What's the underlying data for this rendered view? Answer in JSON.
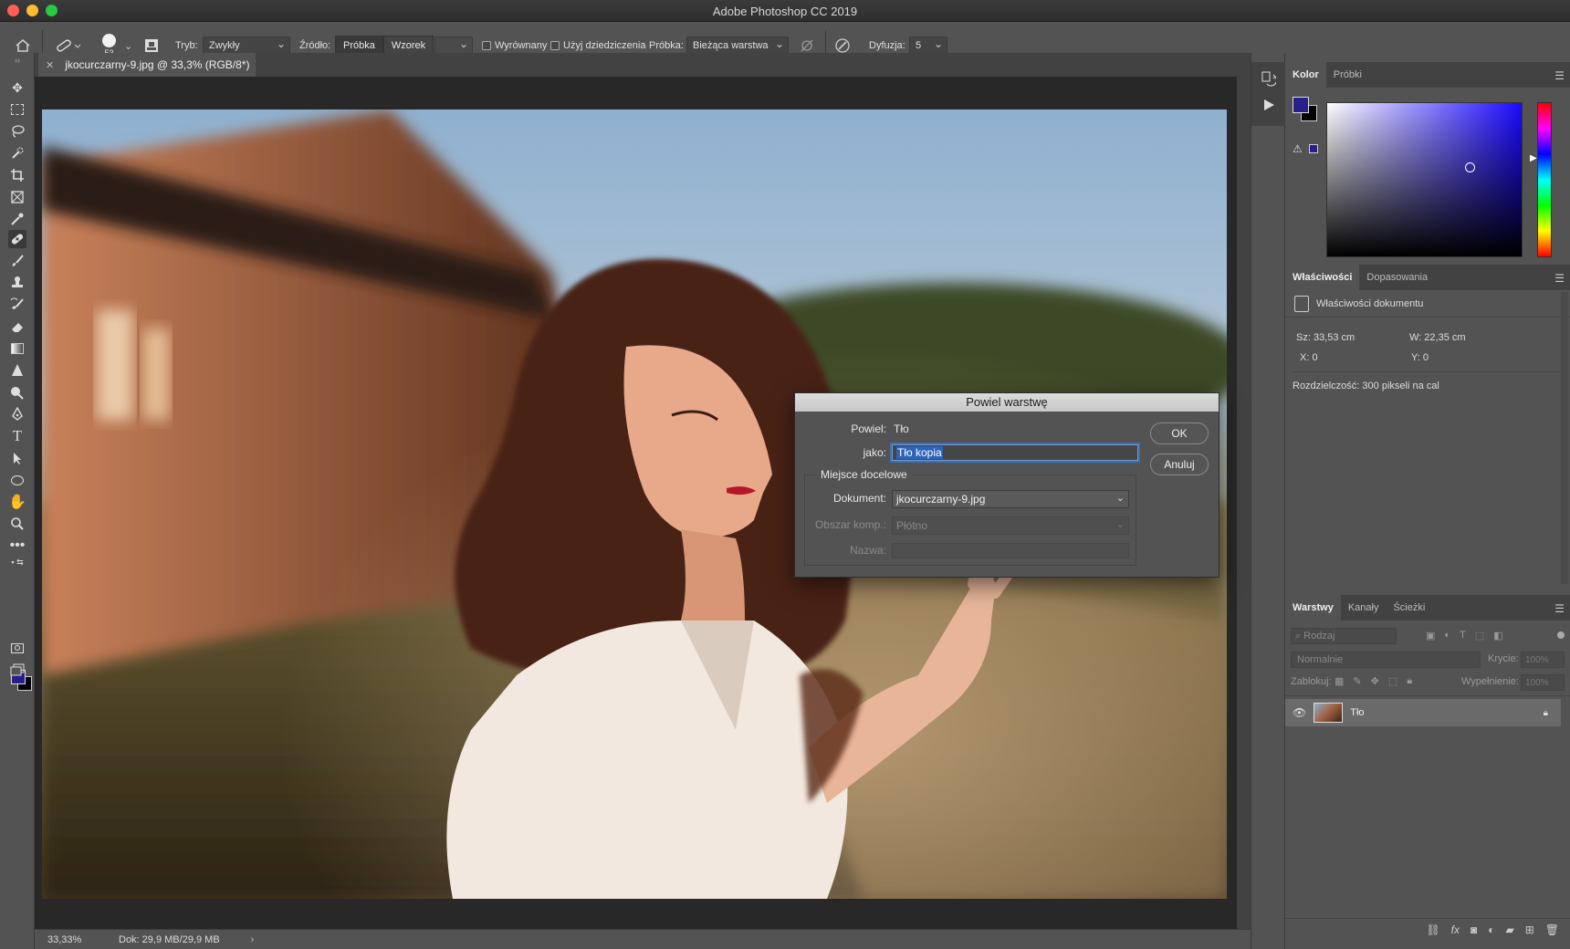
{
  "window": {
    "title": "Adobe Photoshop CC 2019"
  },
  "options_bar": {
    "brush_size": "53",
    "mode_label": "Tryb:",
    "mode_value": "Zwykły",
    "source_label": "Źródło:",
    "source_sampled": "Próbka",
    "source_pattern": "Wzorek",
    "aligned_label": "Wyrównany",
    "legacy_label": "Użyj dziedziczenia",
    "sample_label": "Próbka:",
    "sample_value": "Bieżąca warstwa",
    "diffusion_label": "Dyfuzja:",
    "diffusion_value": "5"
  },
  "document_tab": {
    "title": "jkocurczarny-9.jpg @ 33,3% (RGB/8*)"
  },
  "status_bar": {
    "zoom": "33,33%",
    "doc_info": "Dok: 29,9 MB/29,9 MB"
  },
  "color_panel": {
    "tabs": [
      "Kolor",
      "Próbki"
    ],
    "foreground": "#2a1f8a",
    "background": "#000000"
  },
  "properties_panel": {
    "tabs": [
      "Właściwości",
      "Dopasowania"
    ],
    "header": "Właściwości dokumentu",
    "width": "Sz: 33,53 cm",
    "height": "W: 22,35 cm",
    "x": "X: 0",
    "y": "Y: 0",
    "resolution": "Rozdzielczość: 300 pikseli na cal"
  },
  "layers_panel": {
    "tabs": [
      "Warstwy",
      "Kanały",
      "Ścieżki"
    ],
    "filter_placeholder": "Rodzaj",
    "blend_mode": "Normalnie",
    "opacity_label": "Krycie:",
    "opacity_value": "100%",
    "lock_label": "Zablokuj:",
    "fill_label": "Wypełnienie:",
    "fill_value": "100%",
    "layers": [
      {
        "name": "Tło"
      }
    ]
  },
  "dialog": {
    "title": "Powiel warstwę",
    "duplicate_label": "Powiel:",
    "duplicate_value": "Tło",
    "as_label": "jako:",
    "as_value": "Tło kopia",
    "destination_group": "Miejsce docelowe",
    "document_label": "Dokument:",
    "document_value": "jkocurczarny-9.jpg",
    "artboard_label": "Obszar komp.:",
    "artboard_value": "Płótno",
    "name_label": "Nazwa:",
    "ok_label": "OK",
    "cancel_label": "Anuluj"
  }
}
